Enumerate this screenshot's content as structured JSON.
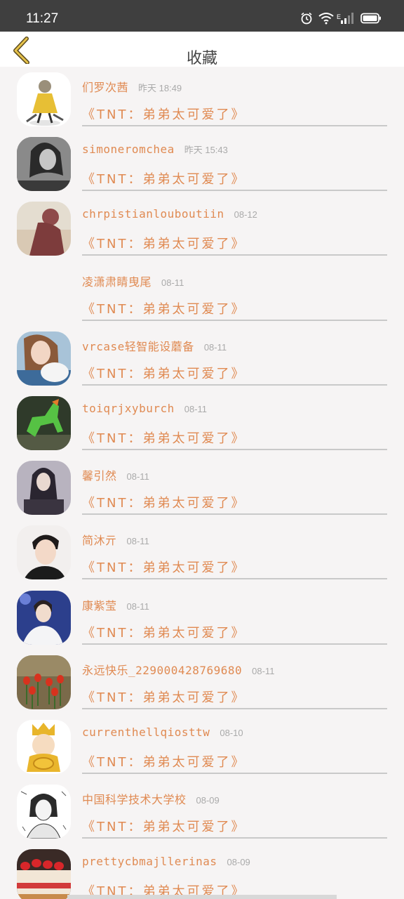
{
  "status_bar": {
    "time": "11:27",
    "network": "E"
  },
  "header": {
    "title": "收藏"
  },
  "collection": {
    "items": [
      {
        "name": "们罗次茜",
        "date": "昨天 18:49",
        "title": "《TNT：弟弟太可爱了》",
        "avatar": "cartoon-figure"
      },
      {
        "name": "simoneromchea",
        "date": "昨天 15:43",
        "title": "《TNT：弟弟太可爱了》",
        "avatar": "girl-bw"
      },
      {
        "name": "chrpistianlouboutiin",
        "date": "08-12",
        "title": "《TNT：弟弟太可爱了》",
        "avatar": "silhouette-girl"
      },
      {
        "name": "凌潇肃睛曳尾",
        "date": "08-11",
        "title": "《TNT：弟弟太可爱了》",
        "avatar": "none"
      },
      {
        "name": "vrcase轻智能设蘑备",
        "date": "08-11",
        "title": "《TNT：弟弟太可爱了》",
        "avatar": "girl-with-pet"
      },
      {
        "name": "toiqrjxyburch",
        "date": "08-11",
        "title": "《TNT：弟弟太可爱了》",
        "avatar": "jade-horse"
      },
      {
        "name": "馨引然",
        "date": "08-11",
        "title": "《TNT：弟弟太可爱了》",
        "avatar": "girl-dark"
      },
      {
        "name": "简沐亓",
        "date": "08-11",
        "title": "《TNT：弟弟太可爱了》",
        "avatar": "boy-portrait"
      },
      {
        "name": "康紫莹",
        "date": "08-11",
        "title": "《TNT：弟弟太可爱了》",
        "avatar": "boy-stage"
      },
      {
        "name": "永远快乐_229000428769680",
        "date": "08-11",
        "title": "《TNT：弟弟太可爱了》",
        "avatar": "tulips"
      },
      {
        "name": "currenthellqiosttw",
        "date": "08-10",
        "title": "《TNT：弟弟太可爱了》",
        "avatar": "fortune-god"
      },
      {
        "name": "中国科学技术大学校",
        "date": "08-09",
        "title": "《TNT：弟弟太可爱了》",
        "avatar": "sketch-girl"
      },
      {
        "name": "prettycbmajllerinas",
        "date": "08-09",
        "title": "《TNT：弟弟太可爱了》",
        "avatar": "strawberry-cake"
      }
    ]
  }
}
